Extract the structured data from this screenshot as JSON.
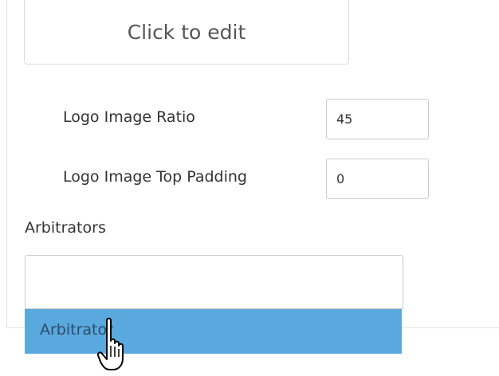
{
  "edit_area": {
    "text": "Click to edit"
  },
  "fields": [
    {
      "label": "Logo Image Ratio",
      "value": "45"
    },
    {
      "label": "Logo Image Top Padding",
      "value": "0"
    }
  ],
  "arbitrators": {
    "label": "Arbitrators",
    "input_value": "",
    "options": [
      "Arbitrator"
    ],
    "highlighted_option": "Arbitrator"
  },
  "colors": {
    "highlight": "#5aa9de",
    "border": "#cccccc"
  },
  "cursor_icon": "hand-pointer-icon"
}
